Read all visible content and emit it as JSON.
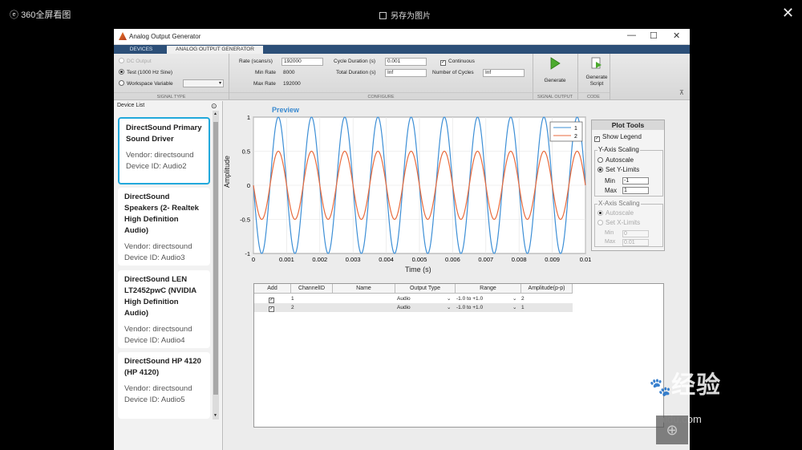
{
  "viewer": {
    "brand": "360全屏看图",
    "save_as_image": "另存为图片"
  },
  "window": {
    "title": "Analog Output Generator"
  },
  "tabs": [
    {
      "label": "DEVICES"
    },
    {
      "label": "ANALOG OUTPUT GENERATOR"
    }
  ],
  "signal_type": {
    "dc_output": "DC Output",
    "test": "Test (1000 Hz Sine)",
    "workspace_variable": "Workspace Variable",
    "section_label": "SIGNAL TYPE"
  },
  "configure": {
    "rate_label": "Rate (scans/s)",
    "rate_value": "192000",
    "min_rate_label": "Min Rate",
    "min_rate_value": "8000",
    "max_rate_label": "Max Rate",
    "max_rate_value": "192000",
    "cycle_duration_label": "Cycle Duration (s)",
    "cycle_duration_value": "0.001",
    "total_duration_label": "Total Duration (s)",
    "total_duration_value": "Inf",
    "continuous_label": "Continuous",
    "number_of_cycles_label": "Number of Cycles",
    "number_of_cycles_value": "Inf",
    "section_label": "CONFIGURE"
  },
  "signal_output": {
    "generate_label": "Generate",
    "section_label": "SIGNAL OUTPUT"
  },
  "code": {
    "generate_script_line1": "Generate",
    "generate_script_line2": "Script",
    "section_label": "CODE"
  },
  "device_list": {
    "header": "Device List",
    "devices": [
      {
        "name": "DirectSound Primary Sound Driver",
        "vendor": "Vendor: directsound",
        "device_id": "Device ID: Audio2"
      },
      {
        "name": "DirectSound Speakers (2- Realtek High Definition Audio)",
        "vendor": "Vendor: directsound",
        "device_id": "Device ID: Audio3"
      },
      {
        "name": "DirectSound LEN LT2452pwC (NVIDIA High Definition Audio)",
        "vendor": "Vendor: directsound",
        "device_id": "Device ID: Audio4"
      },
      {
        "name": "DirectSound HP 4120 (HP 4120)",
        "vendor": "Vendor: directsound",
        "device_id": "Device ID: Audio5"
      }
    ]
  },
  "preview": {
    "title": "Preview"
  },
  "chart_data": {
    "type": "line",
    "title": "Preview",
    "xlabel": "Time (s)",
    "ylabel": "Amplitude",
    "xlim": [
      0,
      0.01
    ],
    "ylim": [
      -1,
      1
    ],
    "x_ticks": [
      "0",
      "0.001",
      "0.002",
      "0.003",
      "0.004",
      "0.005",
      "0.006",
      "0.007",
      "0.008",
      "0.009",
      "0.01"
    ],
    "y_ticks": [
      "1",
      "0.5",
      "0",
      "-0.5",
      "-1"
    ],
    "grid": true,
    "legend_position": "top-right",
    "series": [
      {
        "name": "1",
        "amplitude": 1.0,
        "frequency_hz": 1000,
        "color": "#3d8fd6"
      },
      {
        "name": "2",
        "amplitude": 0.5,
        "frequency_hz": 1000,
        "color": "#e86a3c"
      }
    ]
  },
  "plot_tools": {
    "title": "Plot Tools",
    "show_legend": "Show Legend",
    "y_axis_scaling": "Y-Axis Scaling",
    "autoscale": "Autoscale",
    "set_y_limits": "Set Y-Limits",
    "min_label": "Min",
    "min_value": "-1",
    "max_label": "Max",
    "max_value": "1",
    "x_axis_scaling": "X-Axis Scaling",
    "x_autoscale": "Autoscale",
    "set_x_limits": "Set X-Limits",
    "x_min_label": "Min",
    "x_min_value": "0",
    "x_max_label": "Max",
    "x_max_value": "0.01"
  },
  "channel_table": {
    "headers": [
      "Add",
      "ChannelID",
      "Name",
      "Output Type",
      "Range",
      "Amplitude(p-p)"
    ],
    "rows": [
      {
        "channel_id": "1",
        "name": "",
        "output_type": "Audio",
        "range": "-1.0 to +1.0",
        "amplitude": "2"
      },
      {
        "channel_id": "2",
        "name": "",
        "output_type": "Audio",
        "range": "-1.0 to +1.0",
        "amplitude": "1"
      }
    ]
  },
  "watermark": {
    "brand": "Bai",
    "brand_cn": "经验",
    "url": "jingyan.baidu.com"
  }
}
